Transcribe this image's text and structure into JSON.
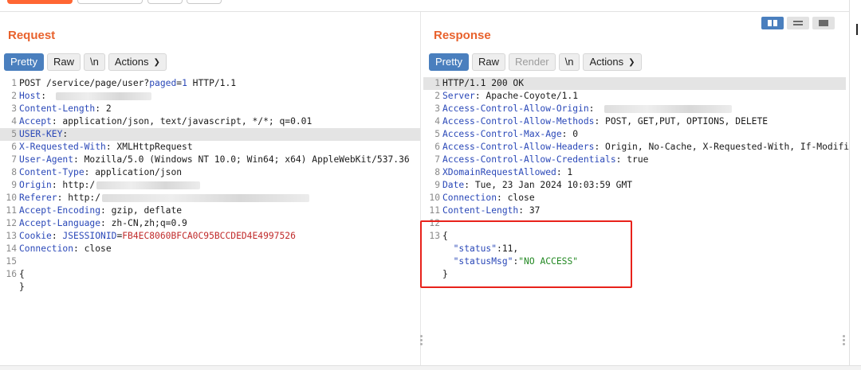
{
  "request": {
    "title": "Request",
    "tabs": [
      "Pretty",
      "Raw",
      "\\n"
    ],
    "actions_label": "Actions",
    "lines": [
      {
        "n": "1",
        "parts": [
          {
            "t": "POST /service/page/user?",
            "c": "val"
          },
          {
            "t": "paged",
            "c": "link"
          },
          {
            "t": "=",
            "c": "val"
          },
          {
            "t": "1",
            "c": "link"
          },
          {
            "t": " HTTP/1.1",
            "c": "val"
          }
        ]
      },
      {
        "n": "2",
        "parts": [
          {
            "t": "Host",
            "c": "key"
          },
          {
            "t": ": ",
            "c": "val"
          }
        ],
        "blur": [
          5,
          120
        ]
      },
      {
        "n": "3",
        "parts": [
          {
            "t": "Content-Length",
            "c": "key"
          },
          {
            "t": ": 2",
            "c": "val"
          }
        ]
      },
      {
        "n": "4",
        "parts": [
          {
            "t": "Accept",
            "c": "key"
          },
          {
            "t": ": application/json, text/javascript, */*; q=0.01",
            "c": "val"
          }
        ]
      },
      {
        "n": "5",
        "hl": true,
        "parts": [
          {
            "t": "USER-KEY",
            "c": "key"
          },
          {
            "t": ":",
            "c": "val"
          }
        ]
      },
      {
        "n": "6",
        "parts": [
          {
            "t": "X-Requested-With",
            "c": "key"
          },
          {
            "t": ": XMLHttpRequest",
            "c": "val"
          }
        ]
      },
      {
        "n": "7",
        "parts": [
          {
            "t": "User-Agent",
            "c": "key"
          },
          {
            "t": ": Mozilla/5.0 (Windows NT 10.0; Win64; x64) AppleWebKit/537.36",
            "c": "val"
          }
        ]
      },
      {
        "n": "8",
        "parts": [
          {
            "t": "Content-Type",
            "c": "key"
          },
          {
            "t": ": application/json",
            "c": "val"
          }
        ]
      },
      {
        "n": "9",
        "parts": [
          {
            "t": "Origin",
            "c": "key"
          },
          {
            "t": ": http:/",
            "c": "val"
          }
        ],
        "blur": [
          2,
          130
        ]
      },
      {
        "n": "10",
        "parts": [
          {
            "t": "Referer",
            "c": "key"
          },
          {
            "t": ": http:/",
            "c": "val"
          }
        ],
        "blur": [
          2,
          260
        ]
      },
      {
        "n": "11",
        "parts": [
          {
            "t": "Accept-Encoding",
            "c": "key"
          },
          {
            "t": ": gzip, deflate",
            "c": "val"
          }
        ]
      },
      {
        "n": "12",
        "parts": [
          {
            "t": "Accept-Language",
            "c": "key"
          },
          {
            "t": ": zh-CN,zh;q=0.9",
            "c": "val"
          }
        ]
      },
      {
        "n": "13",
        "parts": [
          {
            "t": "Cookie",
            "c": "key"
          },
          {
            "t": ": ",
            "c": "val"
          },
          {
            "t": "JSESSIONID",
            "c": "key"
          },
          {
            "t": "=",
            "c": "val"
          },
          {
            "t": "FB4EC8060BFCA0C95BCCDED4E4997526",
            "c": "red"
          }
        ]
      },
      {
        "n": "14",
        "parts": [
          {
            "t": "Connection",
            "c": "key"
          },
          {
            "t": ": close",
            "c": "val"
          }
        ]
      },
      {
        "n": "15",
        "parts": []
      },
      {
        "n": "16",
        "parts": [
          {
            "t": "{",
            "c": "val"
          }
        ]
      },
      {
        "n": "",
        "parts": [
          {
            "t": "}",
            "c": "val"
          }
        ]
      }
    ]
  },
  "response": {
    "title": "Response",
    "tabs": [
      "Pretty",
      "Raw",
      "Render",
      "\\n"
    ],
    "actions_label": "Actions",
    "lines": [
      {
        "n": "1",
        "hl": true,
        "parts": [
          {
            "t": "HTTP/1.1 200 OK",
            "c": "val"
          }
        ]
      },
      {
        "n": "2",
        "parts": [
          {
            "t": "Server",
            "c": "key"
          },
          {
            "t": ": Apache-Coyote/1.1",
            "c": "val"
          }
        ]
      },
      {
        "n": "3",
        "parts": [
          {
            "t": "Access-Control-Allow-Origin",
            "c": "key"
          },
          {
            "t": ": ",
            "c": "val"
          }
        ],
        "blur": [
          6,
          160
        ]
      },
      {
        "n": "4",
        "parts": [
          {
            "t": "Access-Control-Allow-Methods",
            "c": "key"
          },
          {
            "t": ": POST, GET,PUT, OPTIONS, DELETE",
            "c": "val"
          }
        ]
      },
      {
        "n": "5",
        "parts": [
          {
            "t": "Access-Control-Max-Age",
            "c": "key"
          },
          {
            "t": ": 0",
            "c": "val"
          }
        ]
      },
      {
        "n": "6",
        "parts": [
          {
            "t": "Access-Control-Allow-Headers",
            "c": "key"
          },
          {
            "t": ": Origin, No-Cache, X-Requested-With, If-Modifi",
            "c": "val"
          }
        ]
      },
      {
        "n": "7",
        "parts": [
          {
            "t": "Access-Control-Allow-Credentials",
            "c": "key"
          },
          {
            "t": ": true",
            "c": "val"
          }
        ]
      },
      {
        "n": "8",
        "parts": [
          {
            "t": "XDomainRequestAllowed",
            "c": "key"
          },
          {
            "t": ": 1",
            "c": "val"
          }
        ]
      },
      {
        "n": "9",
        "parts": [
          {
            "t": "Date",
            "c": "key"
          },
          {
            "t": ": Tue, 23 Jan 2024 10:03:59 GMT",
            "c": "val"
          }
        ]
      },
      {
        "n": "10",
        "parts": [
          {
            "t": "Connection",
            "c": "key"
          },
          {
            "t": ": close",
            "c": "val"
          }
        ]
      },
      {
        "n": "11",
        "parts": [
          {
            "t": "Content-Length",
            "c": "key"
          },
          {
            "t": ": 37",
            "c": "val"
          }
        ]
      },
      {
        "n": "12",
        "parts": []
      },
      {
        "n": "13",
        "parts": [
          {
            "t": "{",
            "c": "val"
          }
        ]
      },
      {
        "n": "",
        "parts": [
          {
            "t": "  ",
            "c": "val"
          },
          {
            "t": "\"status\"",
            "c": "jkey"
          },
          {
            "t": ":11,",
            "c": "val"
          }
        ]
      },
      {
        "n": "",
        "parts": [
          {
            "t": "  ",
            "c": "val"
          },
          {
            "t": "\"statusMsg\"",
            "c": "jkey"
          },
          {
            "t": ":",
            "c": "val"
          },
          {
            "t": "\"NO ACCESS\"",
            "c": "jstr"
          }
        ]
      },
      {
        "n": "",
        "parts": [
          {
            "t": "}",
            "c": "val"
          }
        ]
      }
    ]
  },
  "icons": {
    "view_split": "split-view-icon",
    "view_horizontal": "horizontal-view-icon",
    "view_single": "single-view-icon",
    "chevron": "chevron-down-icon"
  },
  "colors": {
    "accent": "#e8622d",
    "selected": "#4a7fbe",
    "header_key": "#2a48b8",
    "cookie_value": "#c02a2a",
    "json_string": "#228822",
    "highlight_box": "#e8221b"
  }
}
